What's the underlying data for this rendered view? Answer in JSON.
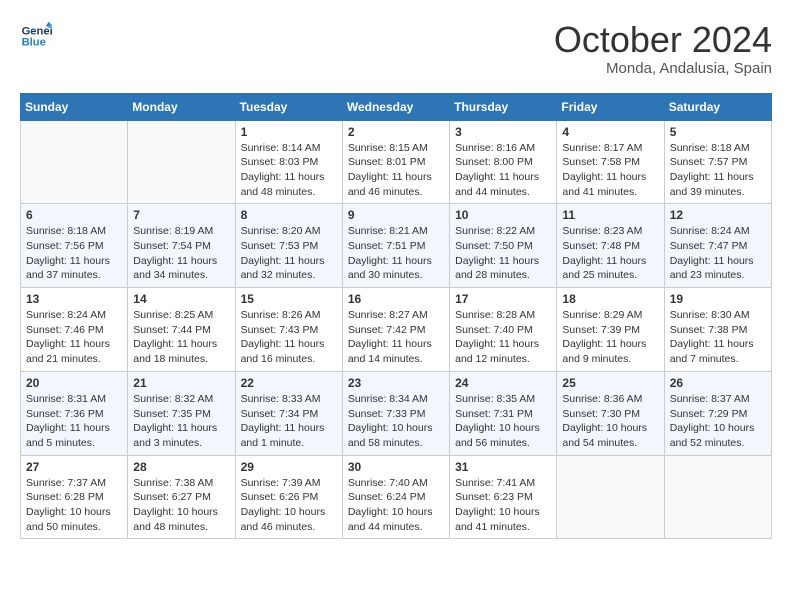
{
  "header": {
    "logo_line1": "General",
    "logo_line2": "Blue",
    "month": "October 2024",
    "location": "Monda, Andalusia, Spain"
  },
  "weekdays": [
    "Sunday",
    "Monday",
    "Tuesday",
    "Wednesday",
    "Thursday",
    "Friday",
    "Saturday"
  ],
  "weeks": [
    [
      {
        "day": "",
        "sunrise": "",
        "sunset": "",
        "daylight": ""
      },
      {
        "day": "",
        "sunrise": "",
        "sunset": "",
        "daylight": ""
      },
      {
        "day": "1",
        "sunrise": "Sunrise: 8:14 AM",
        "sunset": "Sunset: 8:03 PM",
        "daylight": "Daylight: 11 hours and 48 minutes."
      },
      {
        "day": "2",
        "sunrise": "Sunrise: 8:15 AM",
        "sunset": "Sunset: 8:01 PM",
        "daylight": "Daylight: 11 hours and 46 minutes."
      },
      {
        "day": "3",
        "sunrise": "Sunrise: 8:16 AM",
        "sunset": "Sunset: 8:00 PM",
        "daylight": "Daylight: 11 hours and 44 minutes."
      },
      {
        "day": "4",
        "sunrise": "Sunrise: 8:17 AM",
        "sunset": "Sunset: 7:58 PM",
        "daylight": "Daylight: 11 hours and 41 minutes."
      },
      {
        "day": "5",
        "sunrise": "Sunrise: 8:18 AM",
        "sunset": "Sunset: 7:57 PM",
        "daylight": "Daylight: 11 hours and 39 minutes."
      }
    ],
    [
      {
        "day": "6",
        "sunrise": "Sunrise: 8:18 AM",
        "sunset": "Sunset: 7:56 PM",
        "daylight": "Daylight: 11 hours and 37 minutes."
      },
      {
        "day": "7",
        "sunrise": "Sunrise: 8:19 AM",
        "sunset": "Sunset: 7:54 PM",
        "daylight": "Daylight: 11 hours and 34 minutes."
      },
      {
        "day": "8",
        "sunrise": "Sunrise: 8:20 AM",
        "sunset": "Sunset: 7:53 PM",
        "daylight": "Daylight: 11 hours and 32 minutes."
      },
      {
        "day": "9",
        "sunrise": "Sunrise: 8:21 AM",
        "sunset": "Sunset: 7:51 PM",
        "daylight": "Daylight: 11 hours and 30 minutes."
      },
      {
        "day": "10",
        "sunrise": "Sunrise: 8:22 AM",
        "sunset": "Sunset: 7:50 PM",
        "daylight": "Daylight: 11 hours and 28 minutes."
      },
      {
        "day": "11",
        "sunrise": "Sunrise: 8:23 AM",
        "sunset": "Sunset: 7:48 PM",
        "daylight": "Daylight: 11 hours and 25 minutes."
      },
      {
        "day": "12",
        "sunrise": "Sunrise: 8:24 AM",
        "sunset": "Sunset: 7:47 PM",
        "daylight": "Daylight: 11 hours and 23 minutes."
      }
    ],
    [
      {
        "day": "13",
        "sunrise": "Sunrise: 8:24 AM",
        "sunset": "Sunset: 7:46 PM",
        "daylight": "Daylight: 11 hours and 21 minutes."
      },
      {
        "day": "14",
        "sunrise": "Sunrise: 8:25 AM",
        "sunset": "Sunset: 7:44 PM",
        "daylight": "Daylight: 11 hours and 18 minutes."
      },
      {
        "day": "15",
        "sunrise": "Sunrise: 8:26 AM",
        "sunset": "Sunset: 7:43 PM",
        "daylight": "Daylight: 11 hours and 16 minutes."
      },
      {
        "day": "16",
        "sunrise": "Sunrise: 8:27 AM",
        "sunset": "Sunset: 7:42 PM",
        "daylight": "Daylight: 11 hours and 14 minutes."
      },
      {
        "day": "17",
        "sunrise": "Sunrise: 8:28 AM",
        "sunset": "Sunset: 7:40 PM",
        "daylight": "Daylight: 11 hours and 12 minutes."
      },
      {
        "day": "18",
        "sunrise": "Sunrise: 8:29 AM",
        "sunset": "Sunset: 7:39 PM",
        "daylight": "Daylight: 11 hours and 9 minutes."
      },
      {
        "day": "19",
        "sunrise": "Sunrise: 8:30 AM",
        "sunset": "Sunset: 7:38 PM",
        "daylight": "Daylight: 11 hours and 7 minutes."
      }
    ],
    [
      {
        "day": "20",
        "sunrise": "Sunrise: 8:31 AM",
        "sunset": "Sunset: 7:36 PM",
        "daylight": "Daylight: 11 hours and 5 minutes."
      },
      {
        "day": "21",
        "sunrise": "Sunrise: 8:32 AM",
        "sunset": "Sunset: 7:35 PM",
        "daylight": "Daylight: 11 hours and 3 minutes."
      },
      {
        "day": "22",
        "sunrise": "Sunrise: 8:33 AM",
        "sunset": "Sunset: 7:34 PM",
        "daylight": "Daylight: 11 hours and 1 minute."
      },
      {
        "day": "23",
        "sunrise": "Sunrise: 8:34 AM",
        "sunset": "Sunset: 7:33 PM",
        "daylight": "Daylight: 10 hours and 58 minutes."
      },
      {
        "day": "24",
        "sunrise": "Sunrise: 8:35 AM",
        "sunset": "Sunset: 7:31 PM",
        "daylight": "Daylight: 10 hours and 56 minutes."
      },
      {
        "day": "25",
        "sunrise": "Sunrise: 8:36 AM",
        "sunset": "Sunset: 7:30 PM",
        "daylight": "Daylight: 10 hours and 54 minutes."
      },
      {
        "day": "26",
        "sunrise": "Sunrise: 8:37 AM",
        "sunset": "Sunset: 7:29 PM",
        "daylight": "Daylight: 10 hours and 52 minutes."
      }
    ],
    [
      {
        "day": "27",
        "sunrise": "Sunrise: 7:37 AM",
        "sunset": "Sunset: 6:28 PM",
        "daylight": "Daylight: 10 hours and 50 minutes."
      },
      {
        "day": "28",
        "sunrise": "Sunrise: 7:38 AM",
        "sunset": "Sunset: 6:27 PM",
        "daylight": "Daylight: 10 hours and 48 minutes."
      },
      {
        "day": "29",
        "sunrise": "Sunrise: 7:39 AM",
        "sunset": "Sunset: 6:26 PM",
        "daylight": "Daylight: 10 hours and 46 minutes."
      },
      {
        "day": "30",
        "sunrise": "Sunrise: 7:40 AM",
        "sunset": "Sunset: 6:24 PM",
        "daylight": "Daylight: 10 hours and 44 minutes."
      },
      {
        "day": "31",
        "sunrise": "Sunrise: 7:41 AM",
        "sunset": "Sunset: 6:23 PM",
        "daylight": "Daylight: 10 hours and 41 minutes."
      },
      {
        "day": "",
        "sunrise": "",
        "sunset": "",
        "daylight": ""
      },
      {
        "day": "",
        "sunrise": "",
        "sunset": "",
        "daylight": ""
      }
    ]
  ]
}
